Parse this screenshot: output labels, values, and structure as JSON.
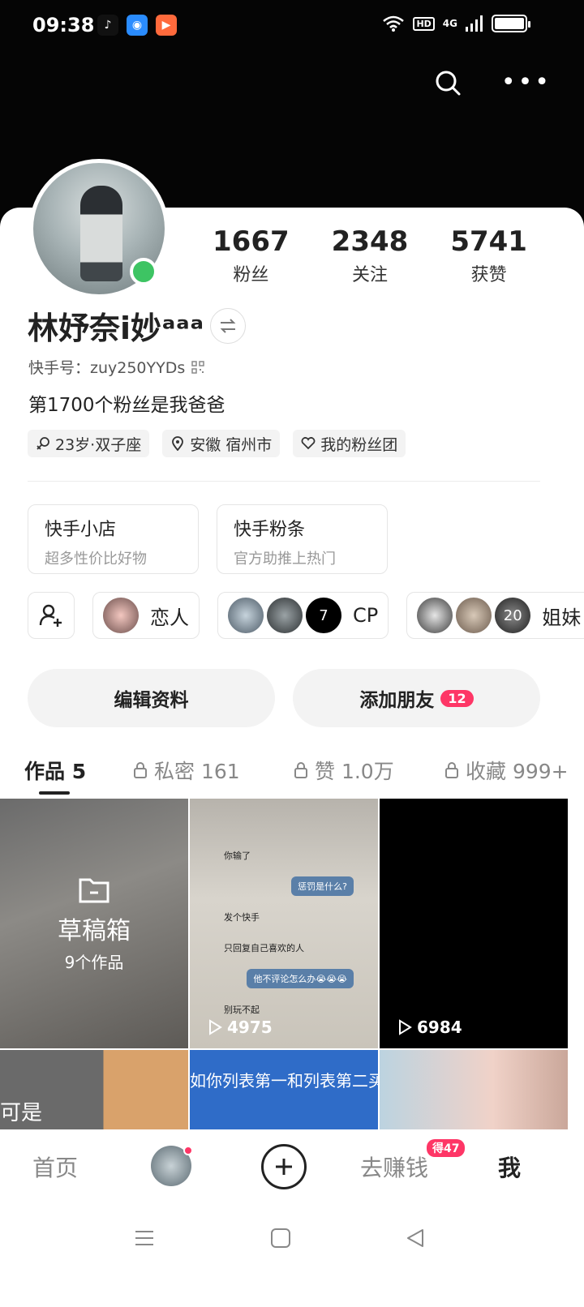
{
  "status_bar": {
    "time": "09:38",
    "apps": [
      "douyin-icon",
      "browser-icon",
      "kuaishou-icon"
    ],
    "network": "4G",
    "hd": "HD"
  },
  "profile": {
    "name": "林妤奈i妙ᵃᵃᵃ",
    "kuaishou_id_label": "快手号：zuy250YYDs",
    "bio": "第1700个粉丝是我爸爸",
    "online": true,
    "stats": [
      {
        "value": "1667",
        "label": "粉丝"
      },
      {
        "value": "2348",
        "label": "关注"
      },
      {
        "value": "5741",
        "label": "获赞"
      }
    ],
    "tags": [
      {
        "icon": "gender-icon",
        "text": "23岁·双子座"
      },
      {
        "icon": "location-icon",
        "text": "安徽 宿州市"
      },
      {
        "icon": "heart-icon",
        "text": "我的粉丝团"
      }
    ]
  },
  "shops": [
    {
      "title": "快手小店",
      "subtitle": "超多性价比好物"
    },
    {
      "title": "快手粉条",
      "subtitle": "官方助推上热门"
    }
  ],
  "relations": [
    {
      "label": "恋人"
    },
    {
      "label": "CP",
      "avatar_text": "7"
    },
    {
      "label": "姐妹",
      "avatar_text": "20"
    }
  ],
  "actions": {
    "edit_profile": "编辑资料",
    "add_friend": "添加朋友",
    "add_friend_badge": "12"
  },
  "tabs": [
    {
      "label": "作品 5",
      "locked": false,
      "active": true
    },
    {
      "label": "私密 161",
      "locked": true,
      "active": false
    },
    {
      "label": "赞 1.0万",
      "locked": true,
      "active": false
    },
    {
      "label": "收藏 999+",
      "locked": true,
      "active": false
    }
  ],
  "grid": {
    "draft_title": "草稿箱",
    "draft_sub": "9个作品",
    "chat_lines": [
      "你输了",
      "惩罚是什么?",
      "发个快手",
      "只回复自己喜欢的人",
      "他不评论怎么办😭😭😭",
      "别玩不起"
    ],
    "video1_plays": "4975",
    "video2_plays": "6984",
    "row2_text_blue": "如你列表第一和列表第二买",
    "row2_text_cat": "可是"
  },
  "bottom_nav": {
    "home": "首页",
    "earn": "去赚钱",
    "earn_badge": "得47",
    "me": "我"
  },
  "colors": {
    "accent": "#fe3666",
    "online": "#3dc463",
    "header_bg": "#050505"
  }
}
